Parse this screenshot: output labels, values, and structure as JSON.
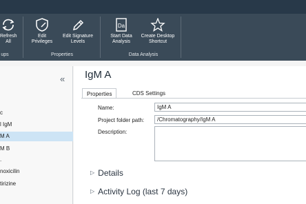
{
  "ribbon": {
    "refresh": {
      "line1": "Refresh",
      "line2": "All"
    },
    "edit_privileges": {
      "line1": "Edit",
      "line2": "Privileges"
    },
    "edit_signature": {
      "line1": "Edit Signature",
      "line2": "Levels"
    },
    "start_data_analysis": {
      "line1": "Start Data",
      "line2": "Analysis"
    },
    "create_desktop_shortcut": {
      "line1": "Create Desktop",
      "line2": "Shortcut"
    },
    "groups": {
      "first": "ups",
      "properties": "Properties",
      "data_analysis": "Data Analysis"
    },
    "icons": {
      "refresh": "refresh-icon",
      "privileges": "shield-edit-icon",
      "signature": "pencil-icon",
      "analysis": "da-icon",
      "shortcut": "star-icon"
    }
  },
  "sidebar": {
    "collapse_glyph": "«",
    "items": [
      {
        "label": "c"
      },
      {
        "label": "l IgM"
      },
      {
        "label": "M A",
        "selected": true
      },
      {
        "label": "M B"
      },
      {
        "label": "."
      },
      {
        "label": "noxicilin"
      },
      {
        "label": "tirizine"
      }
    ]
  },
  "main": {
    "title": "IgM A",
    "tabs": [
      {
        "label": "Properties",
        "active": true
      },
      {
        "label": "CDS Settings"
      }
    ],
    "fields": {
      "name_label": "Name:",
      "name_value": "IgM A",
      "path_label": "Project folder path:",
      "path_value": "/Chromatography/IgM A",
      "description_label": "Description:"
    },
    "sections": {
      "details": "Details",
      "activity": "Activity Log (last 7 days)"
    }
  },
  "colors": {
    "ribbon": "#3a4a58",
    "titlebar": "#283949",
    "selection": "#cde4f5"
  }
}
